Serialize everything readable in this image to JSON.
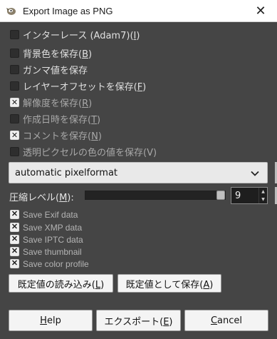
{
  "window": {
    "title": "Export Image as PNG",
    "close_glyph": "✕",
    "app_icon": "gimp-icon"
  },
  "options": [
    {
      "label": "インターレース (Adam7)(",
      "mnemonic": "I",
      "suffix": ")",
      "checked": false,
      "disabled": false
    },
    {
      "label": "背景色を保存(",
      "mnemonic": "B",
      "suffix": ")",
      "checked": false,
      "disabled": false
    },
    {
      "label": "ガンマ値を保存",
      "mnemonic": "",
      "suffix": "",
      "checked": false,
      "disabled": false
    },
    {
      "label": "レイヤーオフセットを保存(",
      "mnemonic": "F",
      "suffix": ")",
      "checked": false,
      "disabled": false
    },
    {
      "label": "解像度を保存(",
      "mnemonic": "R",
      "suffix": ")",
      "checked": true,
      "disabled": true
    },
    {
      "label": "作成日時を保存(",
      "mnemonic": "T",
      "suffix": ")",
      "checked": false,
      "disabled": true
    },
    {
      "label": "コメントを保存(",
      "mnemonic": "N",
      "suffix": ")",
      "checked": true,
      "disabled": true
    },
    {
      "label": "透明ピクセルの色の値を保存(V)",
      "mnemonic": "",
      "suffix": "",
      "checked": false,
      "disabled": true
    }
  ],
  "pixelformat": {
    "value": "automatic pixelformat",
    "icon": "chevron-down-icon"
  },
  "compression": {
    "label_prefix": "圧縮レベル(",
    "mnemonic": "M",
    "label_suffix": "):",
    "value": "9",
    "max": 9,
    "fraction": 1.0
  },
  "metadata": [
    {
      "label": "Save Exif data",
      "checked": true
    },
    {
      "label": "Save XMP data",
      "checked": true
    },
    {
      "label": "Save IPTC data",
      "checked": true
    },
    {
      "label": "Save thumbnail",
      "checked": true
    },
    {
      "label": "Save color profile",
      "checked": true
    }
  ],
  "defaults": {
    "load_label": "既定値の読み込み(",
    "load_mnemonic": "L",
    "load_suffix": ")",
    "save_label": "既定値として保存(",
    "save_mnemonic": "A",
    "save_suffix": ")"
  },
  "actions": {
    "help_label": "Help",
    "help_mnemonic": "H",
    "export_label": "エクスポート(",
    "export_mnemonic": "E",
    "export_suffix": ")",
    "cancel_label": "Cancel",
    "cancel_mnemonic": "C"
  },
  "colors": {
    "background": "#454545",
    "titlebar": "#ffffff",
    "button": "#f4f4f4"
  }
}
